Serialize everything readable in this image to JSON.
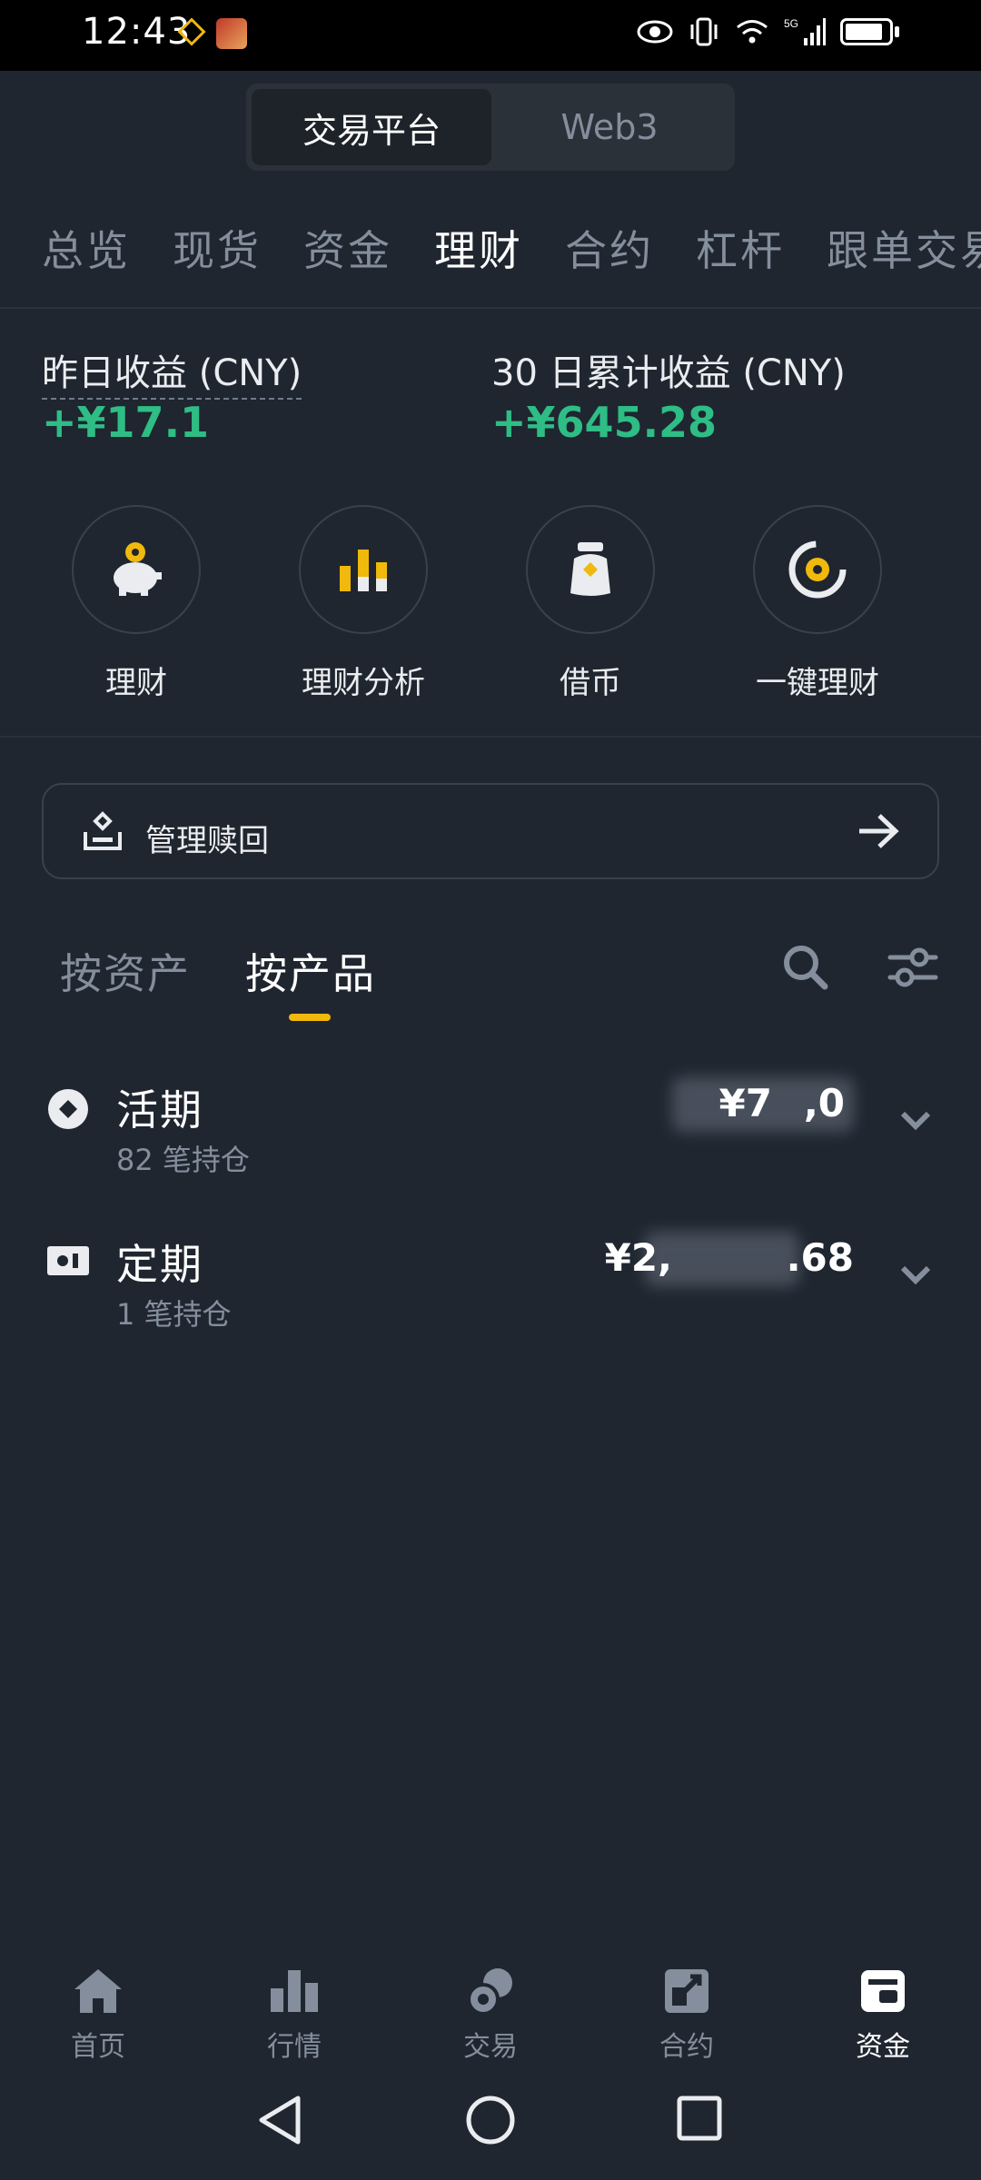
{
  "status_bar": {
    "time": "12:43",
    "network": "5G",
    "icons": [
      "eye-icon",
      "vibrate-icon",
      "wifi-icon",
      "signal-icon",
      "battery-icon"
    ]
  },
  "platform_switch": {
    "options": [
      "交易平台",
      "Web3"
    ],
    "selected": "交易平台"
  },
  "top_tabs": [
    "总览",
    "现货",
    "资金",
    "理财",
    "合约",
    "杠杆",
    "跟单交易"
  ],
  "top_tabs_active": "理财",
  "earnings": {
    "yesterday_label": "昨日收益 (CNY)",
    "yesterday_value": "+¥17.1",
    "month_label": "30 日累计收益 (CNY)",
    "month_value": "+¥645.28"
  },
  "quick_actions": [
    {
      "label": "理财",
      "icon": "piggy-bank-icon"
    },
    {
      "label": "理财分析",
      "icon": "bar-chart-icon"
    },
    {
      "label": "借币",
      "icon": "money-bag-icon"
    },
    {
      "label": "一键理财",
      "icon": "auto-invest-icon"
    }
  ],
  "manage": {
    "label": "管理赎回",
    "icon": "redeem-icon"
  },
  "sub_tabs": [
    "按资产",
    "按产品"
  ],
  "sub_tab_active": "按产品",
  "products": [
    {
      "title": "活期",
      "subtitle": "82 笔持仓",
      "amount_visible": "¥7",
      "amount_tail": ",0",
      "icon": "flexible-icon"
    },
    {
      "title": "定期",
      "subtitle": "1 笔持仓",
      "amount_visible": "¥2,",
      "amount_tail": ".68",
      "icon": "locked-icon"
    }
  ],
  "bottom_nav": [
    {
      "label": "首页",
      "icon": "home-icon"
    },
    {
      "label": "行情",
      "icon": "markets-icon"
    },
    {
      "label": "交易",
      "icon": "trade-icon"
    },
    {
      "label": "合约",
      "icon": "futures-icon"
    },
    {
      "label": "资金",
      "icon": "wallet-icon"
    }
  ],
  "bottom_nav_active": "资金",
  "colors": {
    "background": "#1f2630",
    "accent": "#f0b90b",
    "positive": "#2ebd85",
    "muted": "#848e9c"
  }
}
